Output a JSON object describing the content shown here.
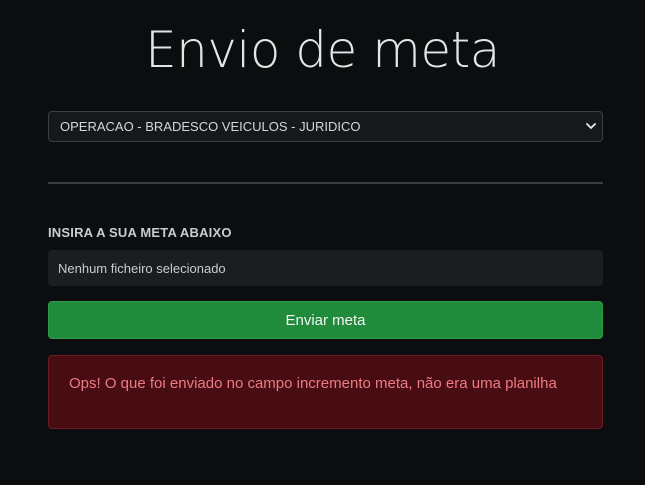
{
  "header": {
    "title": "Envio de meta"
  },
  "form": {
    "operation_select": {
      "selected": "OPERACAO - BRADESCO VEICULOS - JURIDICO"
    },
    "section_label": "INSIRA A SUA META ABAIXO",
    "file_input": {
      "status": "Nenhum ficheiro selecionado"
    },
    "submit_label": "Enviar meta"
  },
  "alert": {
    "message": "Ops! O que foi enviado no campo incremento meta, não era uma planilha"
  },
  "colors": {
    "background": "#0b0d0e",
    "success": "#208b3a",
    "danger_bg": "#470d12",
    "danger_text": "#ef7a84"
  },
  "icons": {
    "select_indicator": "chevron-down-icon"
  }
}
